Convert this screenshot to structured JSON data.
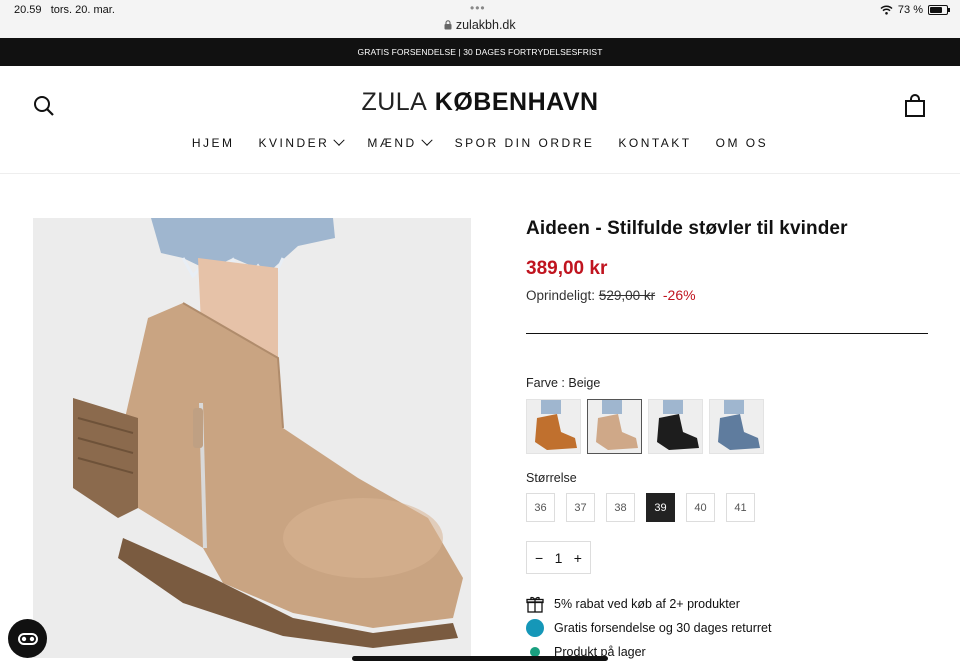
{
  "status_bar": {
    "time": "20.59",
    "date": "tors. 20. mar.",
    "url": "zulakbh.dk",
    "battery": "73 %"
  },
  "announcement": "GRATIS FORSENDELSE | 30 DAGES FORTRYDELSESFRIST",
  "logo": {
    "light": "ZULA",
    "bold": "KØBENHAVN"
  },
  "nav": [
    {
      "label": "HJEM",
      "dropdown": false
    },
    {
      "label": "KVINDER",
      "dropdown": true
    },
    {
      "label": "MÆND",
      "dropdown": true
    },
    {
      "label": "SPOR DIN ORDRE",
      "dropdown": false
    },
    {
      "label": "KONTAKT",
      "dropdown": false
    },
    {
      "label": "OM OS",
      "dropdown": false
    }
  ],
  "product": {
    "title": "Aideen - Stilfulde støvler til kvinder",
    "price": "389,00 kr",
    "original_label": "Oprindeligt:",
    "original_price": "529,00 kr",
    "discount": "-26%",
    "color_label": "Farve : Beige",
    "colors": [
      {
        "name": "cognac",
        "hex": "#c0702e"
      },
      {
        "name": "beige",
        "hex": "#cfa888",
        "selected": true
      },
      {
        "name": "black",
        "hex": "#1d1d1d"
      },
      {
        "name": "denim-blue",
        "hex": "#5f7c9e"
      }
    ],
    "size_label": "Størrelse",
    "sizes": [
      "36",
      "37",
      "38",
      "39",
      "40",
      "41"
    ],
    "selected_size": "39",
    "quantity": "1",
    "qty_minus": "−",
    "qty_plus": "+",
    "perks": [
      {
        "icon": "gift-icon",
        "text": "5% rabat ved køb af 2+ produkter"
      },
      {
        "icon": "shipping-icon",
        "text": "Gratis forsendelse og 30 dages returret"
      },
      {
        "icon": "stock-dot-icon",
        "text": "Produkt på lager"
      }
    ]
  },
  "colors": {
    "price_red": "#c0141f",
    "announcement_bg": "#111111",
    "image_bg": "#ececec"
  }
}
